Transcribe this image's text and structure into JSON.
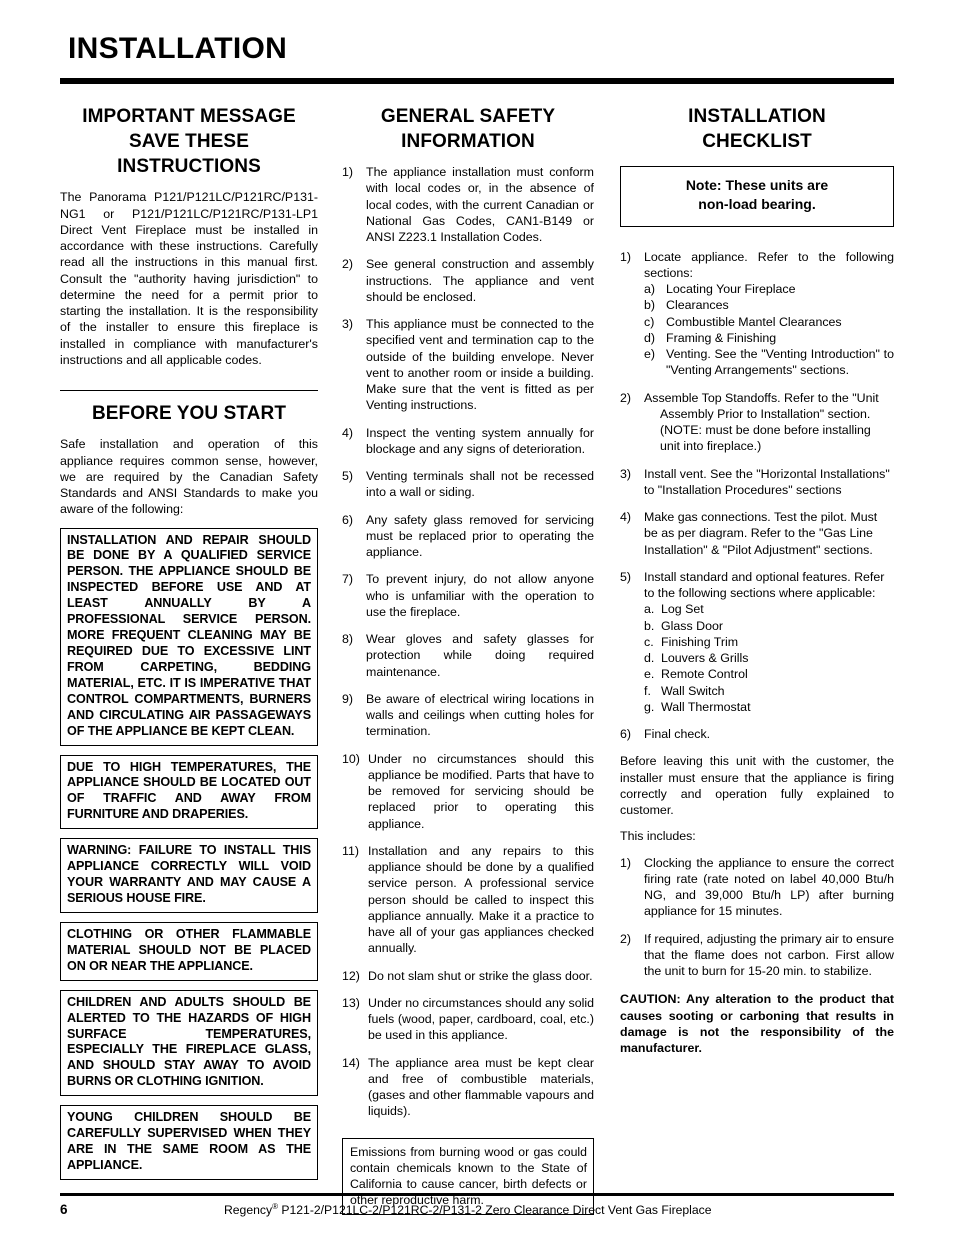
{
  "document": {
    "title": "INSTALLATION",
    "page_number": "6",
    "footer_text": "Regency® P121-2/P121LC-2/P121RC-2/P131-2 Zero Clearance Direct Vent Gas Fireplace",
    "footer_brand": "Regency",
    "footer_registered_mark": "®",
    "footer_models": " P121-2/P121LC-2/P121RC-2/P131-2 Zero Clearance Direct Vent Gas Fireplace"
  },
  "column1": {
    "heading": "IMPORTANT MESSAGE SAVE THESE INSTRUCTIONS",
    "heading_line1": "IMPORTANT MESSAGE",
    "heading_line2": "SAVE THESE",
    "heading_line3": "INSTRUCTIONS",
    "intro_paragraph": "The Panorama P121/P121LC/P121RC/P131-NG1 or P121/P121LC/P121RC/P131-LP1 Direct Vent Fireplace must be installed in accordance with these instructions. Carefully read all the instructions in this manual first. Consult the \"authority having jurisdiction\" to determine the need for a permit prior to starting the installation. It is the responsibility of the installer to ensure this fireplace is installed in compliance with manufacturer's instructions and all applicable codes.",
    "before_you_start_heading": "BEFORE YOU START",
    "before_you_start_paragraph": "Safe installation and operation of this appliance requires common sense, however, we are required by the Canadian Safety Standards and ANSI Standards to make you aware of the following:",
    "warning_boxes": [
      "INSTALLATION AND REPAIR SHOULD BE DONE BY A QUALIFIED SERVICE PERSON. THE APPLIANCE SHOULD BE INSPECTED BEFORE USE AND AT LEAST ANNUALLY BY A PROFESSIONAL SERVICE PERSON. MORE FREQUENT CLEANING MAY BE REQUIRED DUE TO EXCESSIVE LINT FROM CARPETING, BEDDING MATERIAL, ETC. IT IS IMPERATIVE THAT CONTROL COMPARTMENTS, BURNERS AND CIRCULATING AIR PASSAGEWAYS OF THE APPLIANCE BE KEPT CLEAN.",
      "DUE TO HIGH TEMPERATURES, THE APPLIANCE SHOULD BE LOCATED OUT OF TRAFFIC AND AWAY FROM FURNITURE AND DRAPERIES.",
      "WARNING: FAILURE TO INSTALL THIS APPLIANCE CORRECTLY WILL VOID YOUR WARRANTY AND MAY CAUSE A SERIOUS HOUSE FIRE.",
      "CLOTHING OR OTHER FLAMMABLE MATERIAL SHOULD NOT BE PLACED ON OR NEAR THE APPLIANCE.",
      "CHILDREN AND ADULTS SHOULD BE ALERTED TO THE HAZARDS OF HIGH SURFACE TEMPERATURES, ESPECIALLY THE FIREPLACE GLASS, AND SHOULD STAY AWAY TO AVOID BURNS OR CLOTHING IGNITION.",
      "YOUNG CHILDREN SHOULD BE CAREFULLY SUPERVISED WHEN THEY ARE IN THE SAME ROOM AS THE APPLIANCE."
    ]
  },
  "column2": {
    "heading_line1": "GENERAL SAFETY",
    "heading_line2": "INFORMATION",
    "items": [
      {
        "num": "1)",
        "text": "The appliance installation must conform with local codes or, in the absence of local codes, with the current Canadian or National Gas Codes, CAN1-B149 or ANSI  Z223.1 Installation Codes."
      },
      {
        "num": "2)",
        "text": "See general construction and assembly instructions. The appliance and vent should be enclosed."
      },
      {
        "num": "3)",
        "text": "This appliance must be connected to the specified vent and termination cap to the outside of the building envelope. Never vent to another room or inside a building. Make sure that the vent is fitted as per Venting instructions."
      },
      {
        "num": "4)",
        "text": "Inspect the venting system annually for blockage and any signs of deterioration."
      },
      {
        "num": "5)",
        "text": "Venting terminals shall not be recessed into a wall or siding."
      },
      {
        "num": "6)",
        "text": "Any safety glass removed for servicing must be replaced prior to operating the appliance."
      },
      {
        "num": "7)",
        "text": "To prevent injury, do not allow anyone who is unfamiliar with the operation to use the fireplace."
      },
      {
        "num": "8)",
        "text": "Wear gloves and safety glasses for protection while doing required maintenance."
      },
      {
        "num": "9)",
        "text": "Be aware of electrical wiring locations in walls and ceilings when cutting holes for termination."
      },
      {
        "num": "10)",
        "text": "Under no circumstances should this appliance be modified. Parts that have to be removed for servicing should be replaced prior to operating this appliance."
      },
      {
        "num": "11)",
        "text": "Installation and any repairs to this appliance should be done by a qualified service person. A professional service person should be called to inspect this appliance annually. Make it a practice to have all of your gas appliances checked annually."
      },
      {
        "num": "12)",
        "text": "Do not slam shut or strike the glass door."
      },
      {
        "num": "13)",
        "text": "Under no circumstances should any solid fuels (wood, paper, cardboard, coal, etc.) be used in this appliance."
      },
      {
        "num": "14)",
        "text": "The appliance area must be kept clear and free of combustible materials, (gases and other flammable vapours and liquids)."
      }
    ],
    "emissions_box": "Emissions from burning  wood or gas could contain chemicals known to the State of California to  cause cancer, birth defects or other reproductive harm."
  },
  "column3": {
    "heading_line1": "INSTALLATION",
    "heading_line2": "CHECKLIST",
    "note_box_line1": "Note: These units are",
    "note_box_line2": "non-load bearing.",
    "item1": {
      "num": "1)",
      "text": "Locate appliance. Refer to the following sections:",
      "sub": [
        {
          "label": "a)",
          "text": "Locating Your Fireplace"
        },
        {
          "label": "b)",
          "text": "Clearances"
        },
        {
          "label": "c)",
          "text": "Combustible Mantel Clearances"
        },
        {
          "label": "d)",
          "text": "Framing & Finishing"
        },
        {
          "label": "e)",
          "text": "Venting. See the \"Venting Introduction\" to \"Venting Arrangements\" sections."
        }
      ]
    },
    "item2": {
      "num": "2)",
      "text_line1": "Assemble Top Standoffs. Refer to the \"Unit",
      "text_rest": "Assembly Prior to Installation\" section. (NOTE:  must be done before installing unit into fireplace.)"
    },
    "item3": {
      "num": "3)",
      "text": "Install vent. See the \"Horizontal Installations\" to \"Installation Procedures\" sections"
    },
    "item4": {
      "num": "4)",
      "text": "Make gas connections. Test the pilot. Must be as per diagram. Refer to the \"Gas Line Installation\" & \"Pilot Adjustment\" sections."
    },
    "item5": {
      "num": "5)",
      "text": "Install standard and optional features. Refer to the following sections where applicable:",
      "sub": [
        {
          "label": "a.",
          "text": "Log Set"
        },
        {
          "label": "b.",
          "text": "Glass Door"
        },
        {
          "label": "c.",
          "text": "Finishing Trim"
        },
        {
          "label": "d.",
          "text": "Louvers & Grills"
        },
        {
          "label": "e.",
          "text": "Remote Control"
        },
        {
          "label": "f.",
          "text": "Wall Switch"
        },
        {
          "label": "g.",
          "text": "Wall Thermostat"
        }
      ]
    },
    "item6": {
      "num": "6)",
      "text": "Final check."
    },
    "closing_paragraph": "Before leaving this unit with the customer, the installer must ensure that the appliance is firing correctly and operation fully explained to customer.",
    "this_includes_label": "This includes:",
    "includes": [
      {
        "num": "1)",
        "text": "Clocking the appliance to ensure the correct firing rate (rate noted on label 40,000 Btu/h NG, and 39,000 Btu/h LP) after burning appliance for 15 minutes."
      },
      {
        "num": "2)",
        "text": "If required, adjusting the primary air to ensure that the flame does not carbon. First allow the unit to burn for 15-20 min. to stabilize."
      }
    ],
    "caution": "CAUTION: Any alteration to the product that causes sooting or carboning that results in damage is not the responsibility of the manufacturer."
  }
}
